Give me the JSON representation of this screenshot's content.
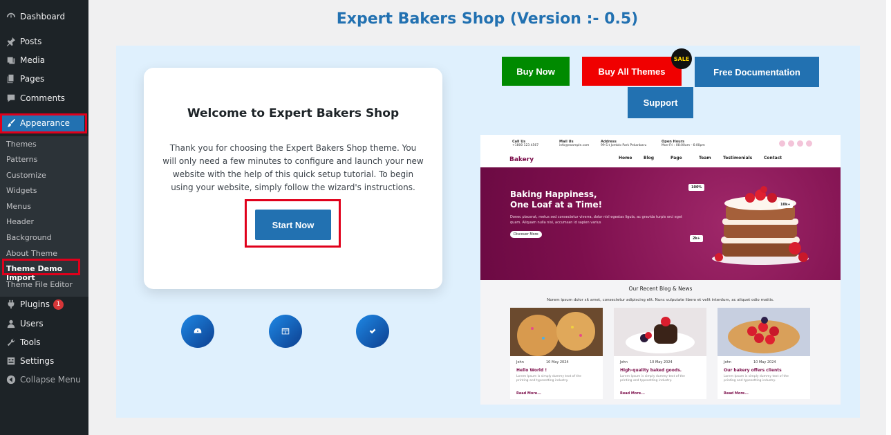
{
  "sidebar": {
    "dashboard": "Dashboard",
    "posts": "Posts",
    "media": "Media",
    "pages": "Pages",
    "comments": "Comments",
    "appearance": "Appearance",
    "submenu": [
      "Themes",
      "Patterns",
      "Customize",
      "Widgets",
      "Menus",
      "Header",
      "Background",
      "About Theme",
      "Theme Demo Import",
      "Theme File Editor"
    ],
    "plugins": "Plugins",
    "plugins_badge": "1",
    "users": "Users",
    "tools": "Tools",
    "settings": "Settings",
    "collapse": "Collapse Menu"
  },
  "main": {
    "title": "Expert Bakers Shop (Version :- 0.5)",
    "welcome_title": "Welcome to Expert Bakers Shop",
    "welcome_text": "Thank you for choosing the Expert Bakers Shop theme. You will only need a few minutes to configure and launch your new website with the help of this quick setup tutorial. To begin using your website, simply follow the wizard's instructions.",
    "start_button": "Start Now",
    "buttons": {
      "buy_now": "Buy Now",
      "buy_all": "Buy All Themes",
      "sale": "SALE",
      "free_docs": "Free Documentation",
      "support": "Support"
    }
  },
  "preview": {
    "call_label": "Call Us",
    "call_value": "+1800 123 4567",
    "mail_label": "Mail Us",
    "mail_value": "info@example.com",
    "address_label": "Address",
    "address_value": "99 S.t Jomblo Park Pekanbaru",
    "hours_label": "Open Hours",
    "hours_value": "Mon-Fri : 08:00am - 6:00pm",
    "logo": "Bakery",
    "nav": [
      "Home",
      "Blog",
      "Page",
      "Team",
      "Testimonials",
      "Contact"
    ],
    "hero_title_1": "Baking Happiness,",
    "hero_title_2": "One Loaf at a Time!",
    "hero_text": "Donec placerat, metus sed consectetur viverra, dolor nisl egestas ligula, ac gravida turpis orci eget quam. Aliquam nulla nisi, accumsan id sapien varius",
    "discover": "Discover More",
    "stat_1": "100%",
    "stat_2": "10k+",
    "stat_3": "2k+",
    "blog_title": "Our Recent Blog & News",
    "blog_sub": "Norem ipsum dolor sit amet, consectetur adipiscing elit. Nunc vulputate libero et velit interdum, ac aliquet odio mattis.",
    "cards": [
      {
        "author": "John",
        "date": "10 May 2024",
        "title": "Hello World !",
        "text": "Lorem Ipsum is simply dummy text of the printing and typesetting industry.",
        "read": "Read More..."
      },
      {
        "author": "John",
        "date": "10 May 2024",
        "title": "High-quality baked goods.",
        "text": "Lorem Ipsum is simply dummy text of the printing and typesetting industry.",
        "read": "Read More..."
      },
      {
        "author": "John",
        "date": "10 May 2024",
        "title": "Our bakery offers clients",
        "text": "Lorem Ipsum is simply dummy text of the printing and typesetting industry.",
        "read": "Read More..."
      }
    ]
  },
  "colors": {
    "wp_blue": "#2271b1",
    "buy_green": "#008a00",
    "buy_red": "#f00000",
    "highlight": "#e0001b",
    "bakery_plum": "#7a0c49"
  }
}
